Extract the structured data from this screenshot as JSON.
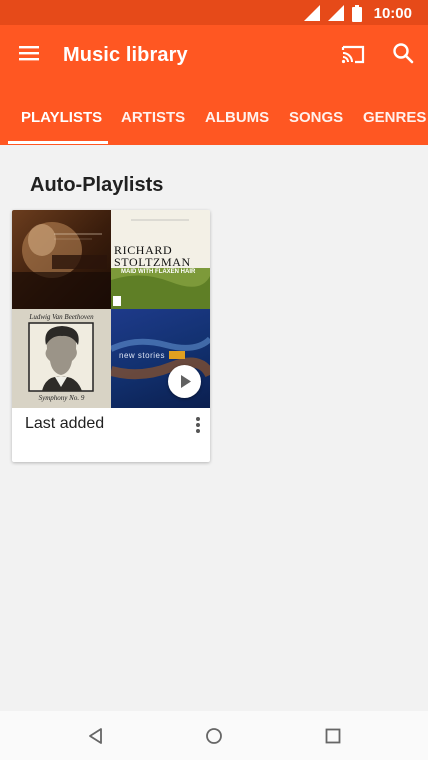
{
  "status": {
    "time": "10:00",
    "icons": [
      "signal-icon",
      "signal-icon",
      "battery-icon"
    ]
  },
  "appbar": {
    "title": "Music library",
    "icons": [
      "menu-icon",
      "cast-icon",
      "search-icon"
    ]
  },
  "tabs": [
    {
      "label": "PLAYLISTS",
      "active": true
    },
    {
      "label": "ARTISTS",
      "active": false
    },
    {
      "label": "ALBUMS",
      "active": false
    },
    {
      "label": "SONGS",
      "active": false
    },
    {
      "label": "GENRES",
      "active": false
    }
  ],
  "section": {
    "title": "Auto-Playlists"
  },
  "playlists": [
    {
      "label": "Last added",
      "art": {
        "tile2_title": "RICHARD STOLTZMAN",
        "tile2_subtitle": "MAID WITH FLAXEN HAIR",
        "tile3_title": "Ludwig Van Beethoven",
        "tile3_subtitle": "Symphony No. 9",
        "tile4_title": "new stories"
      }
    }
  ],
  "colors": {
    "accent": "#ff5722",
    "statusbar": "#e64a19"
  }
}
